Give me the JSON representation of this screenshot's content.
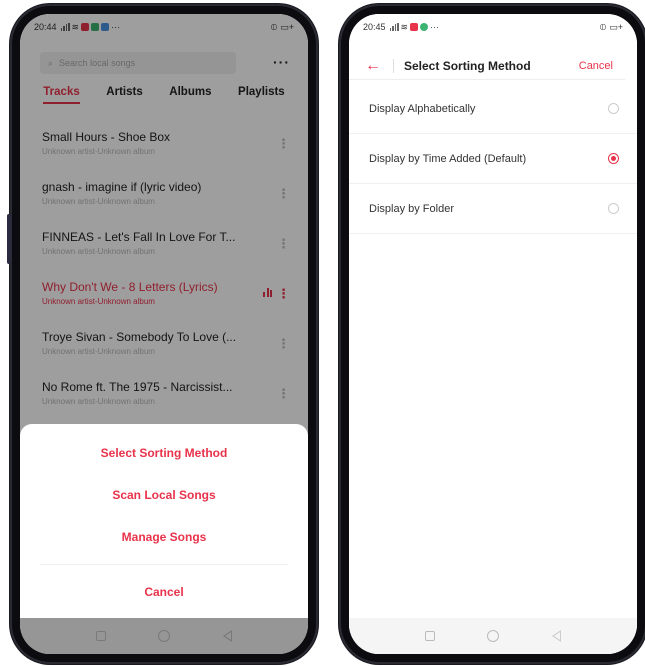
{
  "left_screen": {
    "status": {
      "time": "20:44",
      "extra": "···"
    },
    "search": {
      "placeholder": "Search local songs"
    },
    "tabs": [
      {
        "label": "Tracks",
        "active": true
      },
      {
        "label": "Artists",
        "active": false
      },
      {
        "label": "Albums",
        "active": false
      },
      {
        "label": "Playlists",
        "active": false
      }
    ],
    "tracks": [
      {
        "title": "Small Hours - Shoe Box",
        "subtitle": "Unknown artist-Unknown album",
        "playing": false
      },
      {
        "title": "gnash - imagine if (lyric video)",
        "subtitle": "Unknown artist-Unknown album",
        "playing": false
      },
      {
        "title": "FINNEAS - Let's Fall In Love For T...",
        "subtitle": "Unknown artist-Unknown album",
        "playing": false
      },
      {
        "title": "Why Don't We - 8 Letters (Lyrics)",
        "subtitle": "Unknown artist-Unknown album",
        "playing": true
      },
      {
        "title": "Troye Sivan - Somebody To Love (...",
        "subtitle": "Unknown artist-Unknown album",
        "playing": false
      },
      {
        "title": "No Rome ft. The 1975 - Narcissist...",
        "subtitle": "Unknown artist-Unknown album",
        "playing": false
      }
    ],
    "sheet": {
      "options": [
        "Select Sorting Method",
        "Scan Local Songs",
        "Manage Songs"
      ],
      "cancel": "Cancel"
    }
  },
  "right_screen": {
    "status": {
      "time": "20:45",
      "extra": "···"
    },
    "header": {
      "title": "Select Sorting Method",
      "cancel": "Cancel"
    },
    "options": [
      {
        "label": "Display Alphabetically",
        "selected": false
      },
      {
        "label": "Display by Time Added (Default)",
        "selected": true
      },
      {
        "label": "Display by Folder",
        "selected": false
      }
    ]
  },
  "colors": {
    "accent": "#e8334a",
    "overlay": "rgba(0,0,0,0.38)"
  }
}
